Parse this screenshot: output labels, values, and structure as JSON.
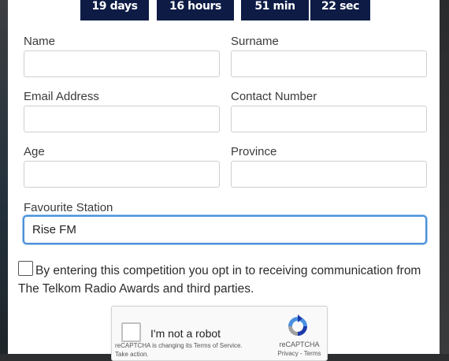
{
  "countdown": {
    "days": "19 days",
    "hours": "16 hours",
    "minutes": "51 min",
    "seconds": "22 sec"
  },
  "form": {
    "name_label": "Name",
    "surname_label": "Surname",
    "email_label": "Email Address",
    "contact_label": "Contact Number",
    "age_label": "Age",
    "province_label": "Province",
    "station_label": "Favourite Station",
    "station_value": "Rise FM",
    "consent_text": "By entering this competition you opt in to receiving communication from The Telkom Radio Awards and third parties."
  },
  "recaptcha": {
    "label": "I'm not a robot",
    "brand": "reCAPTCHA",
    "notice": "reCAPTCHA is changing its Terms of Service.",
    "notice_link": "Take action.",
    "links": "Privacy - Terms",
    "logo_icon": "recaptcha-logo-icon"
  },
  "colors": {
    "countdown_bg": "#0d1b45",
    "focus_border": "#4a90d9"
  }
}
